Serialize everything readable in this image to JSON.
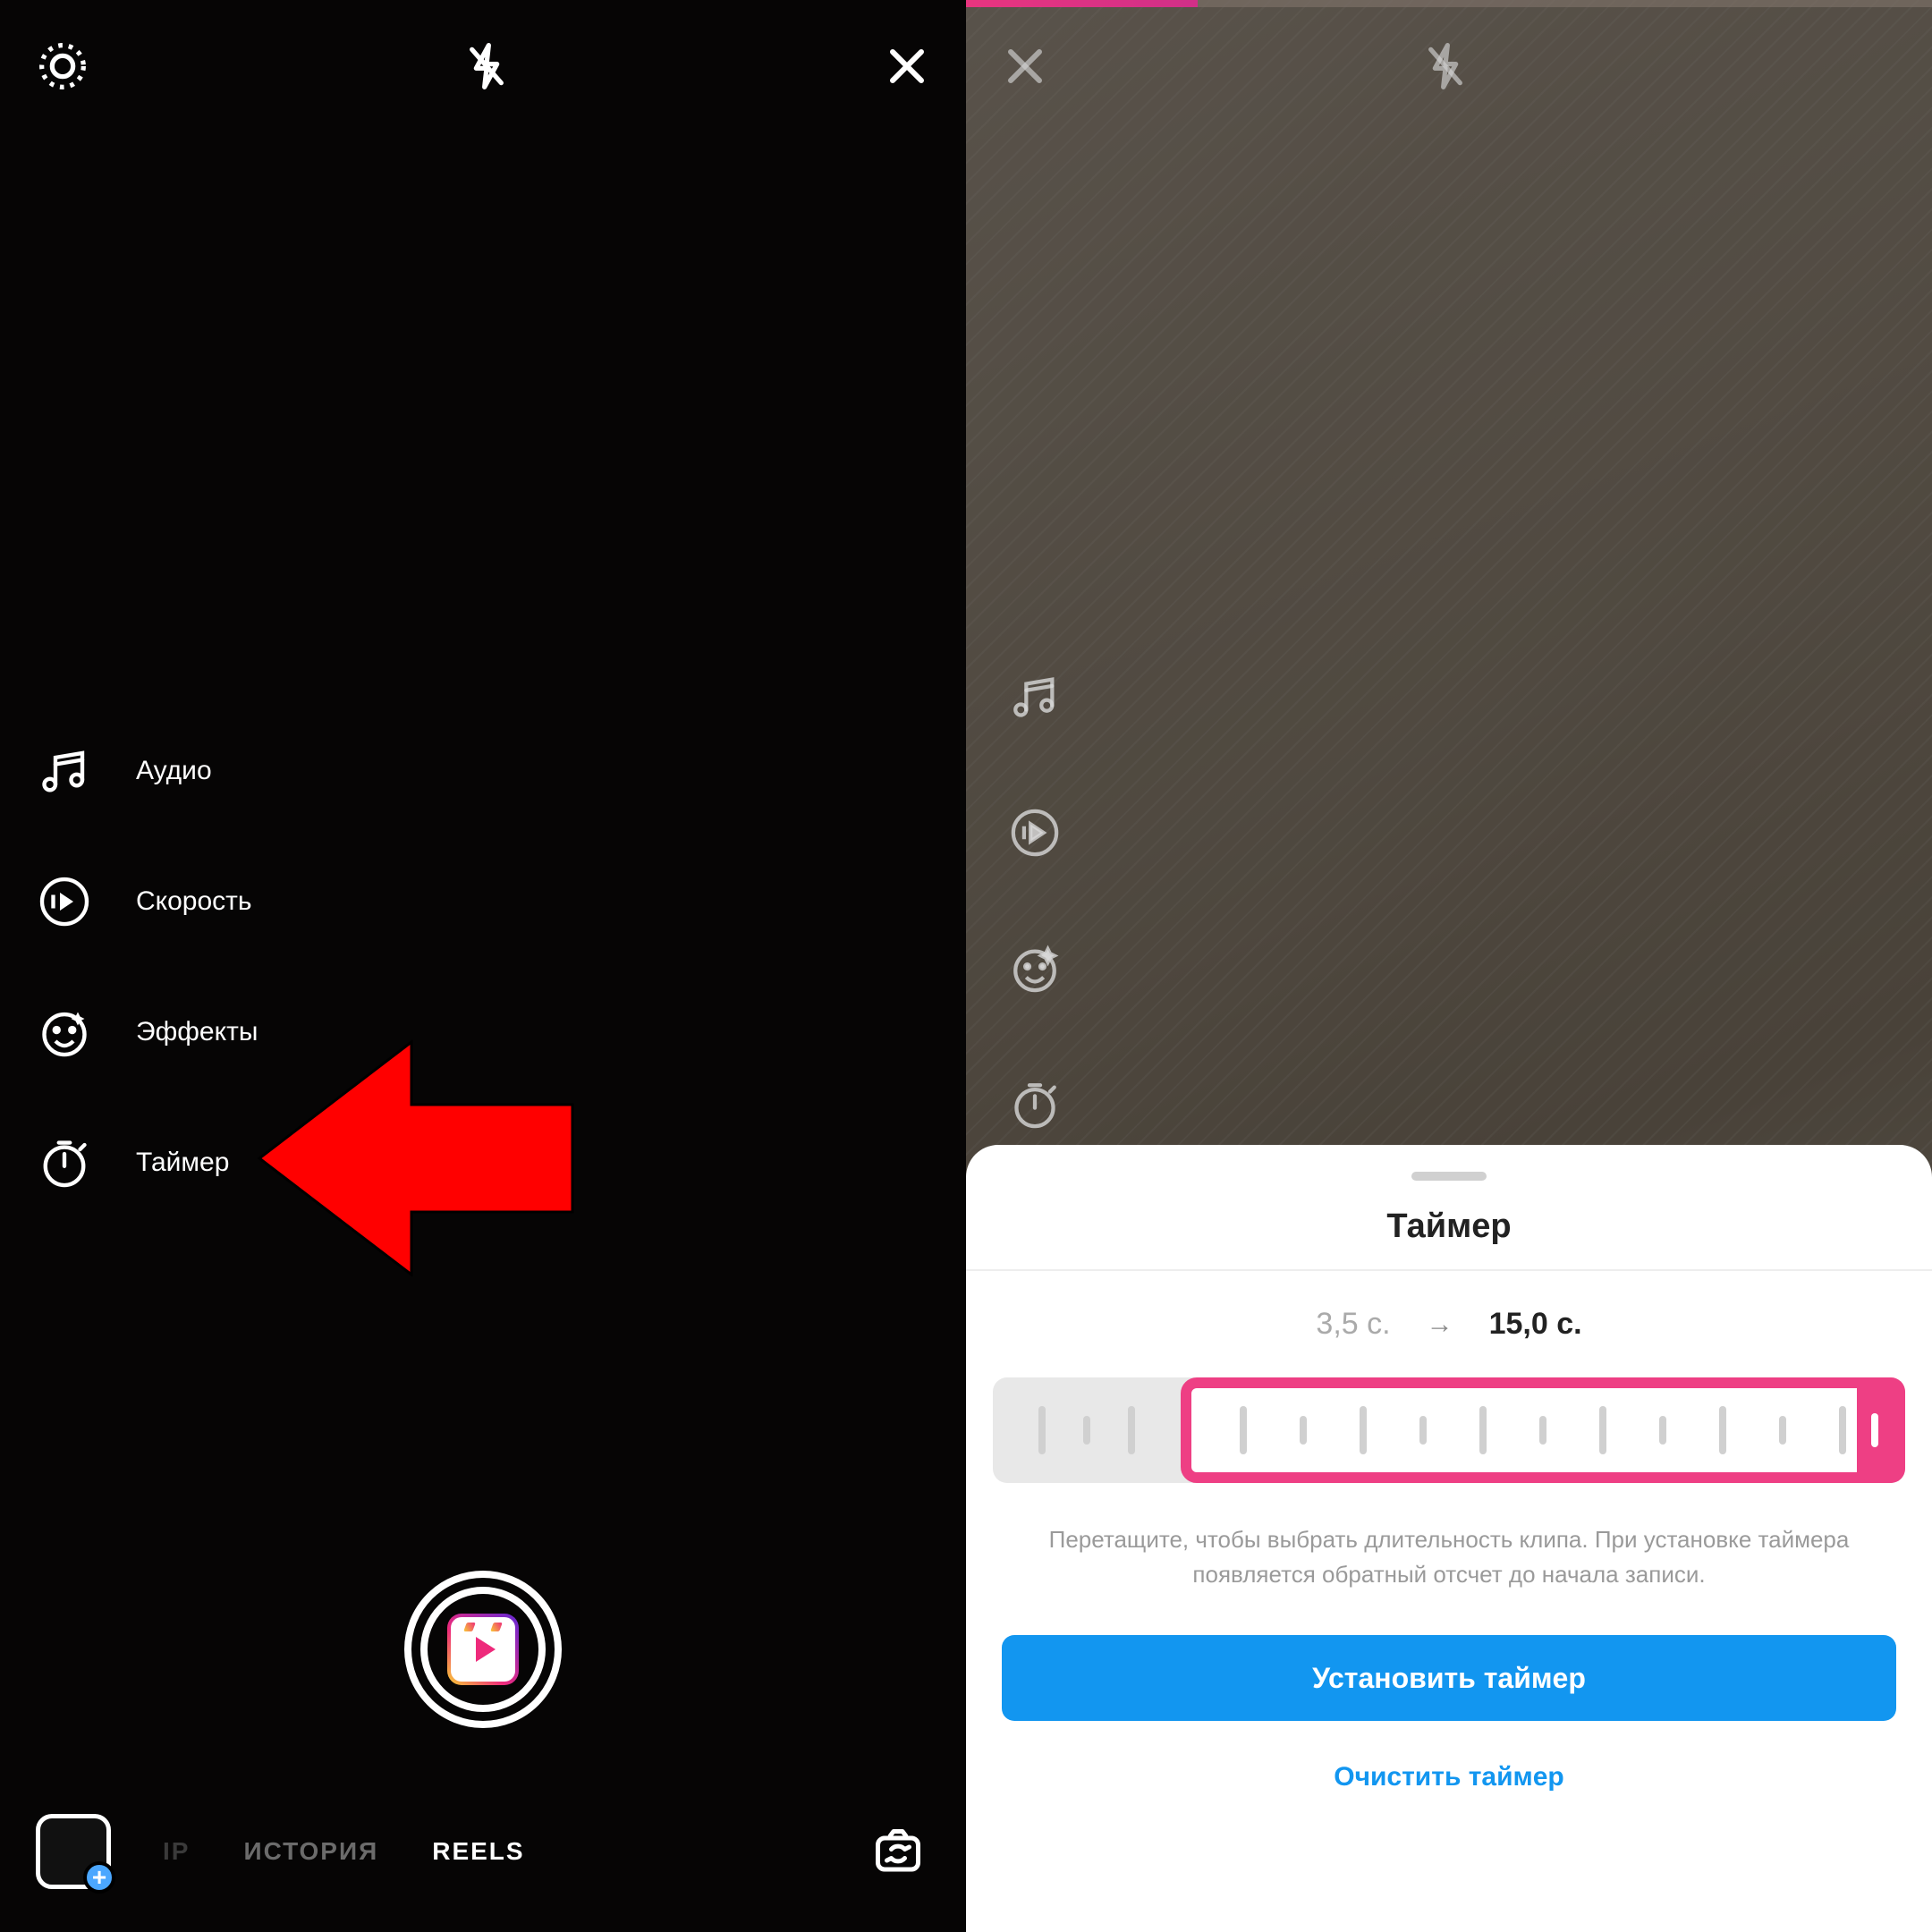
{
  "left": {
    "tools": {
      "audio": "Аудио",
      "speed": "Скорость",
      "effects": "Эффекты",
      "timer": "Таймер"
    },
    "modes": {
      "clip_partial": "IP",
      "story": "ИСТОРИЯ",
      "reels": "REELS"
    }
  },
  "right": {
    "sheet": {
      "title": "Таймер",
      "from": "3,5 с.",
      "arrow": "→",
      "to": "15,0 с.",
      "hint": "Перетащите, чтобы выбрать длительность клипа. При установке таймера появляется обратный отсчет до начала записи.",
      "set_button": "Установить таймер",
      "clear_button": "Очистить таймер"
    }
  }
}
